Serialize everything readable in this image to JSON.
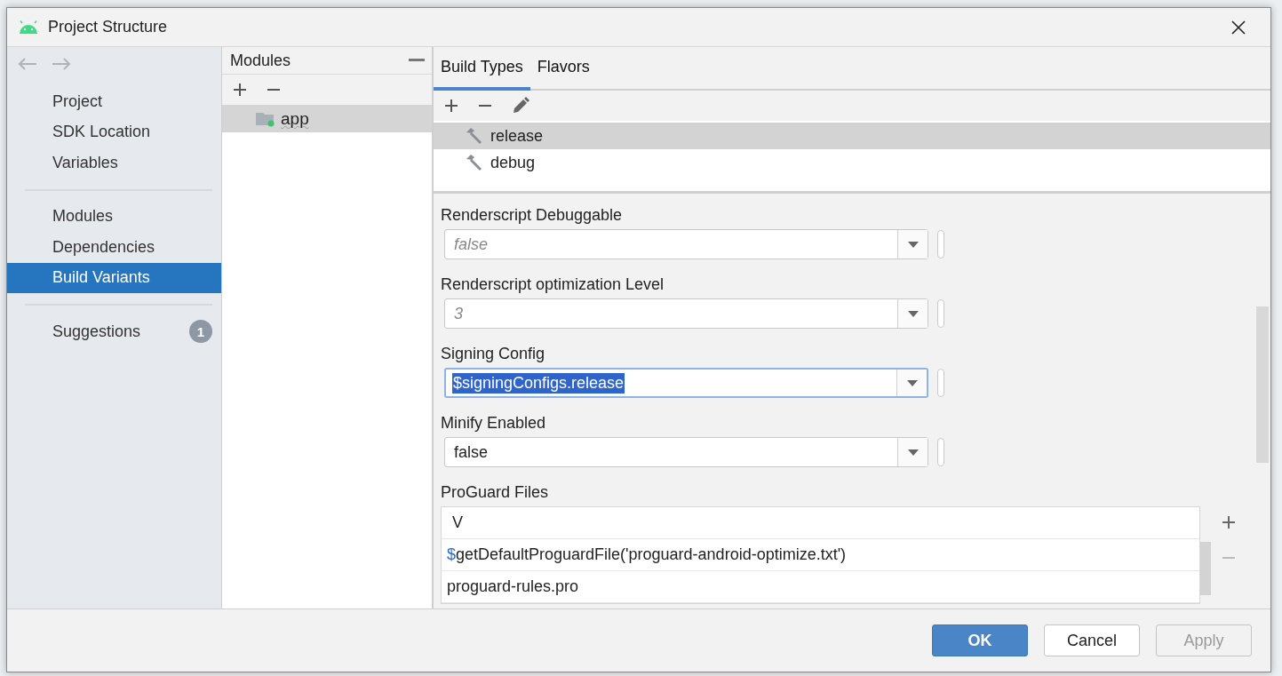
{
  "window": {
    "title": "Project Structure"
  },
  "nav": {
    "back_disabled": true,
    "forward_disabled": true
  },
  "sidebar": {
    "groups": [
      [
        {
          "label": "Project",
          "selected": false
        },
        {
          "label": "SDK Location",
          "selected": false
        },
        {
          "label": "Variables",
          "selected": false
        }
      ],
      [
        {
          "label": "Modules",
          "selected": false
        },
        {
          "label": "Dependencies",
          "selected": false
        },
        {
          "label": "Build Variants",
          "selected": true
        }
      ],
      [
        {
          "label": "Suggestions",
          "selected": false,
          "badge": "1"
        }
      ]
    ]
  },
  "modules": {
    "title": "Modules",
    "items": [
      {
        "name": "app",
        "selected": true
      }
    ]
  },
  "tabs": [
    {
      "label": "Build Types",
      "selected": true
    },
    {
      "label": "Flavors",
      "selected": false
    }
  ],
  "build_types": [
    {
      "name": "release",
      "selected": true
    },
    {
      "name": "debug",
      "selected": false
    }
  ],
  "properties": [
    {
      "kind": "combo",
      "label": "Renderscript Debuggable",
      "value": "false",
      "inherited": true,
      "focused": false
    },
    {
      "kind": "combo",
      "label": "Renderscript optimization Level",
      "value": "3",
      "inherited": true,
      "focused": false
    },
    {
      "kind": "combo",
      "label": "Signing Config",
      "value": "$signingConfigs.release",
      "inherited": false,
      "focused": true
    },
    {
      "kind": "combo",
      "label": "Minify Enabled",
      "value": "false",
      "inherited": false,
      "focused": false
    },
    {
      "kind": "list",
      "label": "ProGuard Files",
      "rows": [
        {
          "kind": "input",
          "text": "V"
        },
        {
          "kind": "file",
          "prefix": "$",
          "text": "getDefaultProguardFile('proguard-android-optimize.txt')"
        },
        {
          "kind": "file",
          "text": "proguard-rules.pro"
        }
      ]
    }
  ],
  "buttons": [
    {
      "label": "OK",
      "default": true,
      "disabled": false
    },
    {
      "label": "Cancel",
      "default": false,
      "disabled": false
    },
    {
      "label": "Apply",
      "default": false,
      "disabled": true
    }
  ]
}
